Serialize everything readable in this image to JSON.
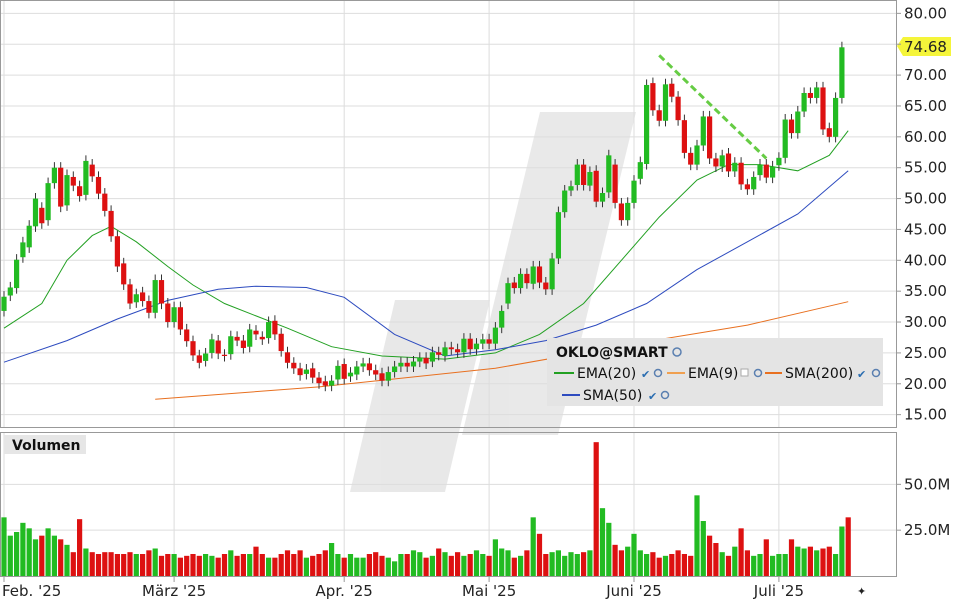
{
  "chart_data": [
    {
      "type": "candlestick",
      "title": "OKLO@SMART",
      "ylim": [
        13,
        82
      ],
      "yticks": [
        "80.00",
        "75.00",
        "70.00",
        "65.00",
        "60.00",
        "55.00",
        "50.00",
        "45.00",
        "40.00",
        "35.00",
        "30.00",
        "25.00",
        "20.00",
        "15.00"
      ],
      "ytick_values": [
        80,
        75,
        70,
        65,
        60,
        55,
        50,
        45,
        40,
        35,
        30,
        25,
        20,
        15
      ],
      "last_price": "74.68",
      "x_labels": [
        "Feb. '25",
        "März '25",
        "Apr. '25",
        "Mai '25",
        "Juni '25",
        "Juli '25"
      ],
      "x_label_index": [
        0,
        27,
        54,
        77,
        100,
        123
      ],
      "candles": [
        [
          31.8,
          34.1
        ],
        [
          34.3,
          35.6
        ],
        [
          35.5,
          40.1
        ],
        [
          40.5,
          42.9
        ],
        [
          42.1,
          45.6
        ],
        [
          45.5,
          50.0
        ],
        [
          48.5,
          46.0
        ],
        [
          46.5,
          52.5
        ],
        [
          52.5,
          55.0
        ],
        [
          55.0,
          48.7
        ],
        [
          48.9,
          53.8
        ],
        [
          53.5,
          52.1
        ],
        [
          52.0,
          50.4
        ],
        [
          50.6,
          56.1
        ],
        [
          55.5,
          53.6
        ],
        [
          53.5,
          50.8
        ],
        [
          50.8,
          48.0
        ],
        [
          48.0,
          43.9
        ],
        [
          43.9,
          39.0
        ],
        [
          39.5,
          36.1
        ],
        [
          36.1,
          33.0
        ],
        [
          33.2,
          34.5
        ],
        [
          34.8,
          33.4
        ],
        [
          33.4,
          31.5
        ],
        [
          31.5,
          36.8
        ],
        [
          36.8,
          33.0
        ],
        [
          33.0,
          30.0
        ],
        [
          30.0,
          32.4
        ],
        [
          32.4,
          28.8
        ],
        [
          28.8,
          26.9
        ],
        [
          26.9,
          24.6
        ],
        [
          24.6,
          23.4
        ],
        [
          23.7,
          24.9
        ],
        [
          25.0,
          27.2
        ],
        [
          27.0,
          24.9
        ],
        [
          24.7,
          24.5
        ],
        [
          24.8,
          27.7
        ],
        [
          27.6,
          27.0
        ],
        [
          27.0,
          25.8
        ],
        [
          26.0,
          28.8
        ],
        [
          28.6,
          28.0
        ],
        [
          27.6,
          27.2
        ],
        [
          27.4,
          30.0
        ],
        [
          30.2,
          28.0
        ],
        [
          28.1,
          25.3
        ],
        [
          25.1,
          23.4
        ],
        [
          23.4,
          22.5
        ],
        [
          22.5,
          21.4
        ],
        [
          21.6,
          22.3
        ],
        [
          22.5,
          21.0
        ],
        [
          21.0,
          20.1
        ],
        [
          20.4,
          19.7
        ],
        [
          19.7,
          20.5
        ],
        [
          20.7,
          22.9
        ],
        [
          23.2,
          20.8
        ],
        [
          21.2,
          21.8
        ],
        [
          21.5,
          22.8
        ],
        [
          22.8,
          23.3
        ],
        [
          23.3,
          22.2
        ],
        [
          22.2,
          21.5
        ],
        [
          21.7,
          20.5
        ],
        [
          20.5,
          21.9
        ],
        [
          21.9,
          22.8
        ],
        [
          22.8,
          23.4
        ],
        [
          23.4,
          22.8
        ],
        [
          22.8,
          23.6
        ],
        [
          23.6,
          24.2
        ],
        [
          24.2,
          23.3
        ],
        [
          23.6,
          25.1
        ],
        [
          25.1,
          24.7
        ],
        [
          24.5,
          25.9
        ],
        [
          25.9,
          25.6
        ],
        [
          25.6,
          25.1
        ],
        [
          25.1,
          27.3
        ],
        [
          27.3,
          25.6
        ],
        [
          25.6,
          26.5
        ],
        [
          26.5,
          27.2
        ],
        [
          27.2,
          26.5
        ],
        [
          26.5,
          29.1
        ],
        [
          29.1,
          31.8
        ],
        [
          33.0,
          36.3
        ],
        [
          36.4,
          35.5
        ],
        [
          35.5,
          37.8
        ],
        [
          37.8,
          36.3
        ],
        [
          36.2,
          39.0
        ],
        [
          39.0,
          36.4
        ],
        [
          36.4,
          35.3
        ],
        [
          35.3,
          40.3
        ],
        [
          40.3,
          47.8
        ],
        [
          47.8,
          51.3
        ],
        [
          51.3,
          52.0
        ],
        [
          52.2,
          55.5
        ],
        [
          55.5,
          52.2
        ],
        [
          52.1,
          54.3
        ],
        [
          54.5,
          49.5
        ],
        [
          49.5,
          50.9
        ],
        [
          51.0,
          57.0
        ],
        [
          55.5,
          49.3
        ],
        [
          49.2,
          46.5
        ],
        [
          46.5,
          49.3
        ],
        [
          49.3,
          52.9
        ],
        [
          53.2,
          55.9
        ],
        [
          55.6,
          68.4
        ],
        [
          68.7,
          64.3
        ],
        [
          64.3,
          62.6
        ],
        [
          62.6,
          68.5
        ],
        [
          68.6,
          66.5
        ],
        [
          66.5,
          62.7
        ],
        [
          62.7,
          57.4
        ],
        [
          57.4,
          55.5
        ],
        [
          55.5,
          58.6
        ],
        [
          58.6,
          63.3
        ],
        [
          63.3,
          56.5
        ],
        [
          56.5,
          55.2
        ],
        [
          55.2,
          57.0
        ],
        [
          57.3,
          54.4
        ],
        [
          54.4,
          55.8
        ],
        [
          55.8,
          52.3
        ],
        [
          52.3,
          51.5
        ],
        [
          51.5,
          53.5
        ],
        [
          53.8,
          55.5
        ],
        [
          55.5,
          53.4
        ],
        [
          53.4,
          55.2
        ],
        [
          55.4,
          56.6
        ],
        [
          56.6,
          62.8
        ],
        [
          62.8,
          60.6
        ],
        [
          60.6,
          64.1
        ],
        [
          64.1,
          67.1
        ],
        [
          67.1,
          66.3
        ],
        [
          66.3,
          68.0
        ],
        [
          68.0,
          61.2
        ],
        [
          61.4,
          60.0
        ],
        [
          60.0,
          66.3
        ],
        [
          66.3,
          74.5
        ]
      ],
      "series": [
        {
          "name": "EMA(20)",
          "color": "#22a022",
          "width": 1,
          "values": [
            [
              0,
              29
            ],
            [
              6,
              33
            ],
            [
              10,
              40
            ],
            [
              14,
              44
            ],
            [
              17,
              45.5
            ],
            [
              21,
              43
            ],
            [
              26,
              39
            ],
            [
              30,
              36
            ],
            [
              35,
              33
            ],
            [
              40,
              31
            ],
            [
              45,
              29
            ],
            [
              52,
              26
            ],
            [
              60,
              24.5
            ],
            [
              70,
              24
            ],
            [
              78,
              25
            ],
            [
              85,
              28
            ],
            [
              92,
              33
            ],
            [
              98,
              40
            ],
            [
              104,
              47
            ],
            [
              110,
              53
            ],
            [
              115,
              55.5
            ],
            [
              120,
              55.5
            ],
            [
              126,
              54.5
            ],
            [
              131,
              57
            ],
            [
              134,
              61
            ]
          ]
        },
        {
          "name": "SMA(50)",
          "color": "#2d4bbf",
          "width": 1,
          "values": [
            [
              0,
              23.5
            ],
            [
              10,
              27
            ],
            [
              18,
              30.5
            ],
            [
              26,
              33.5
            ],
            [
              34,
              35.3
            ],
            [
              40,
              35.8
            ],
            [
              48,
              35.6
            ],
            [
              54,
              34
            ],
            [
              62,
              28
            ],
            [
              70,
              24.5
            ],
            [
              78,
              25.5
            ],
            [
              86,
              27
            ],
            [
              94,
              29.5
            ],
            [
              102,
              33
            ],
            [
              110,
              38.5
            ],
            [
              118,
              43
            ],
            [
              126,
              47.5
            ],
            [
              134,
              54.5
            ]
          ]
        },
        {
          "name": "SMA(200)",
          "color": "#e87020",
          "width": 1,
          "values": [
            [
              24,
              17.5
            ],
            [
              50,
              19.5
            ],
            [
              78,
              22.5
            ],
            [
              100,
              26.5
            ],
            [
              118,
              29.5
            ],
            [
              134,
              33.3
            ]
          ]
        },
        {
          "name": "EMA(9)",
          "color": "#f0a050",
          "width": 1,
          "values": []
        }
      ],
      "trendline": {
        "from": [
          104,
          73.2
        ],
        "to": [
          121,
          56.5
        ],
        "color": "#66cc44"
      }
    },
    {
      "type": "bar",
      "title": "Volumen",
      "yticks": [
        "50.0M",
        "25.0M"
      ],
      "ytick_values": [
        50,
        25
      ],
      "ylim": [
        0,
        78
      ],
      "values": [
        32,
        22,
        24,
        29,
        26,
        20,
        22,
        26,
        22,
        20,
        17,
        13,
        31,
        15,
        13,
        12,
        13,
        13,
        12,
        12,
        13,
        12,
        12,
        14,
        15,
        11,
        12,
        12,
        10,
        11,
        12,
        11,
        12,
        11,
        10,
        12,
        14,
        11,
        12,
        12,
        16,
        12,
        10,
        10,
        12,
        14,
        12,
        14,
        10,
        11,
        12,
        14,
        18,
        12,
        10,
        12,
        10,
        10,
        12,
        13,
        11,
        10,
        8,
        12,
        12,
        14,
        13,
        10,
        11,
        15,
        13,
        11,
        13,
        11,
        12,
        14,
        12,
        11,
        20,
        15,
        14,
        10,
        11,
        14,
        32,
        23,
        12,
        13,
        14,
        11,
        13,
        12,
        13,
        14,
        73,
        37,
        29,
        17,
        14,
        16,
        23,
        14,
        12,
        13,
        10,
        11,
        12,
        14,
        12,
        11,
        44,
        30,
        22,
        18,
        13,
        11,
        16,
        26,
        14,
        11,
        12,
        20,
        11,
        12,
        12,
        20,
        16,
        15,
        16,
        14,
        15,
        16,
        12,
        27,
        32
      ]
    }
  ],
  "legend": {
    "title": "OKLO@SMART",
    "items": [
      {
        "name": "EMA(20)",
        "color": "#22a022"
      },
      {
        "name": "EMA(9)",
        "color": "#f0a050"
      },
      {
        "name": "SMA(200)",
        "color": "#e87020"
      },
      {
        "name": "SMA(50)",
        "color": "#2d4bbf"
      }
    ]
  },
  "colors": {
    "up": "#22bb22",
    "down": "#dd1111",
    "last_price_bg": "#f5f53a",
    "volume_panel_header": "#e6e6e6",
    "legend_bg": "#e4e4e4"
  }
}
